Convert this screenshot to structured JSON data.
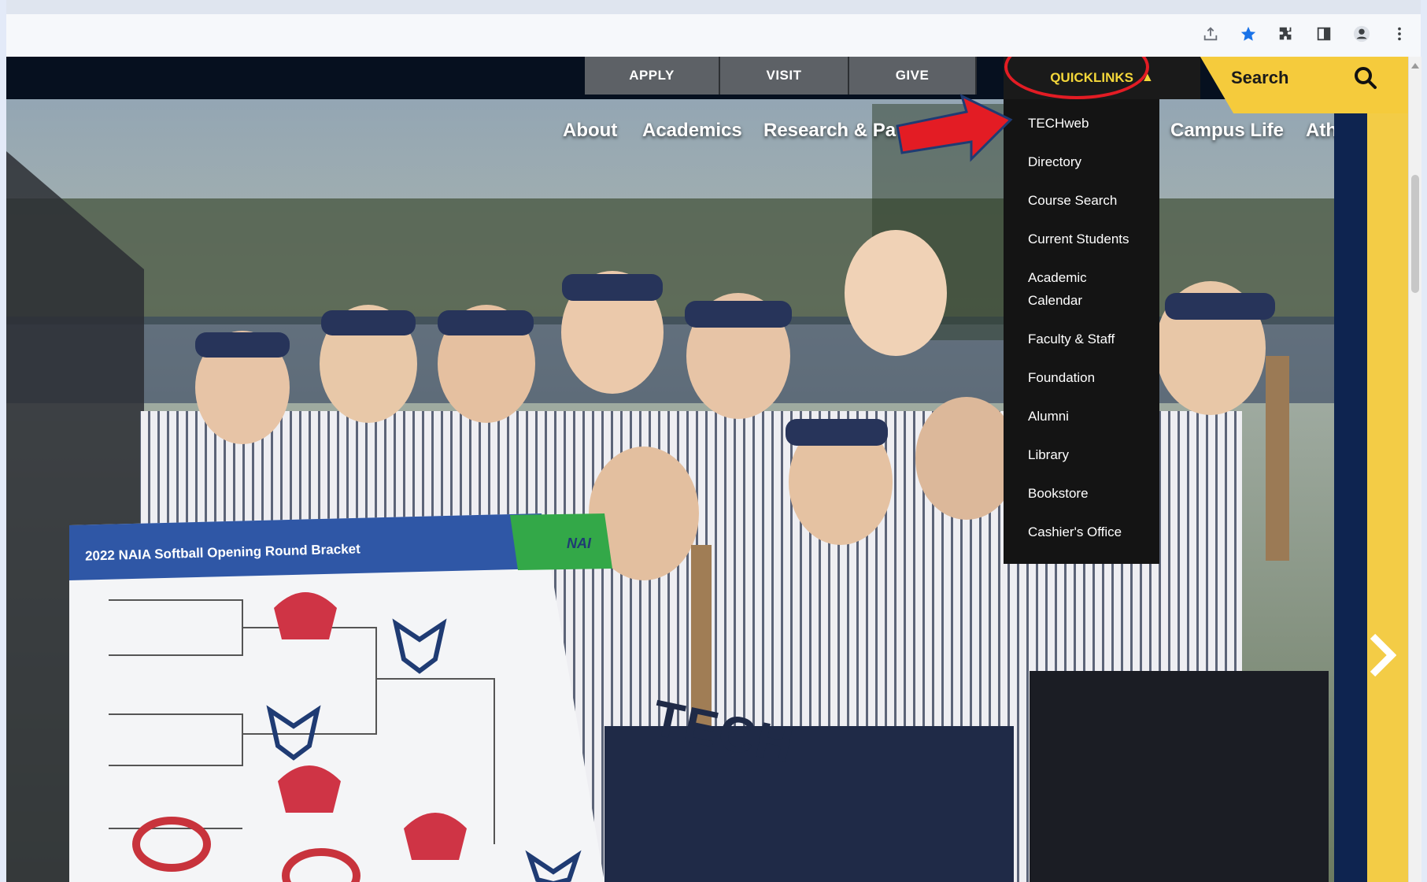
{
  "browser": {
    "icons": [
      "share-icon",
      "bookmark-star-icon",
      "extensions-icon",
      "side-panel-icon",
      "profile-icon",
      "menu-icon"
    ]
  },
  "site": {
    "utility": {
      "apply": "APPLY",
      "visit": "VISIT",
      "give": "GIVE",
      "quicklinks": "QUICKLINKS",
      "search": "Search"
    },
    "nav": {
      "about": "About",
      "academics": "Academics",
      "research": "Research & Pa",
      "campus_life": "Campus Life",
      "athletics": "Athletics"
    },
    "dropdown": {
      "items": [
        "TECHweb",
        "Directory",
        "Course Search",
        "Current Students",
        "Academic Calendar",
        "Faculty & Staff",
        "Foundation",
        "Alumni",
        "Library",
        "Bookstore",
        "Cashier's Office"
      ]
    },
    "poster": {
      "title": "2022 NAIA Softball Opening Round Bracket",
      "badge": "NAI"
    },
    "jersey_text": "TECH"
  },
  "colors": {
    "nav_dark": "#06101f",
    "utility_gray": "#5d6166",
    "quicklinks_yellow": "#f4d73a",
    "search_yellow": "#f5cb3c",
    "navy": "#0e2450",
    "annotation_red": "#e31c24"
  }
}
